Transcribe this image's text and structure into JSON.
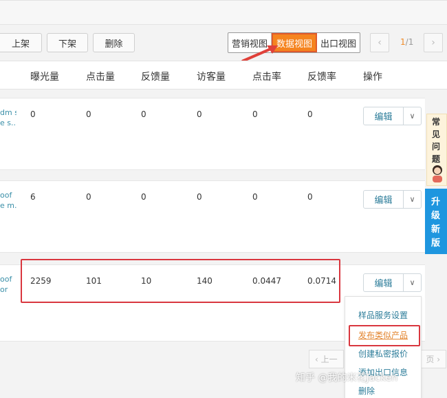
{
  "toolbar": {
    "shelf_on": "上架",
    "shelf_off": "下架",
    "delete": "删除",
    "views": [
      "营销视图",
      "数据视图",
      "出口视图"
    ],
    "active_view": "数据视图",
    "prev": "‹",
    "next": "›",
    "page_current": "1",
    "page_sep": "/",
    "page_total": "1"
  },
  "table": {
    "columns": [
      "曝光量",
      "点击量",
      "反馈量",
      "访客量",
      "点击率",
      "反馈率",
      "操作"
    ],
    "rows": [
      {
        "product": [
          "dm s",
          "e s..."
        ],
        "values": [
          "0",
          "0",
          "0",
          "0",
          "0",
          "0"
        ]
      },
      {
        "product": [
          "oof",
          "e m..."
        ],
        "values": [
          "6",
          "0",
          "0",
          "0",
          "0",
          "0"
        ]
      },
      {
        "product": [
          "oof",
          "or"
        ],
        "values": [
          "2259",
          "101",
          "10",
          "140",
          "0.0447",
          "0.0714"
        ]
      }
    ],
    "edit_label": "编辑",
    "dropdown_icon": "∨"
  },
  "menu": {
    "items": [
      "样品服务设置",
      "发布类似产品",
      "创建私密报价",
      "添加出口信息",
      "删除"
    ]
  },
  "side": {
    "faq": "常见问题",
    "upgrade": "升级新版"
  },
  "bottom_pager": {
    "prev": "‹ 上一",
    "next": "页 ›"
  },
  "watermark": "知乎 @我的米花Jacken"
}
